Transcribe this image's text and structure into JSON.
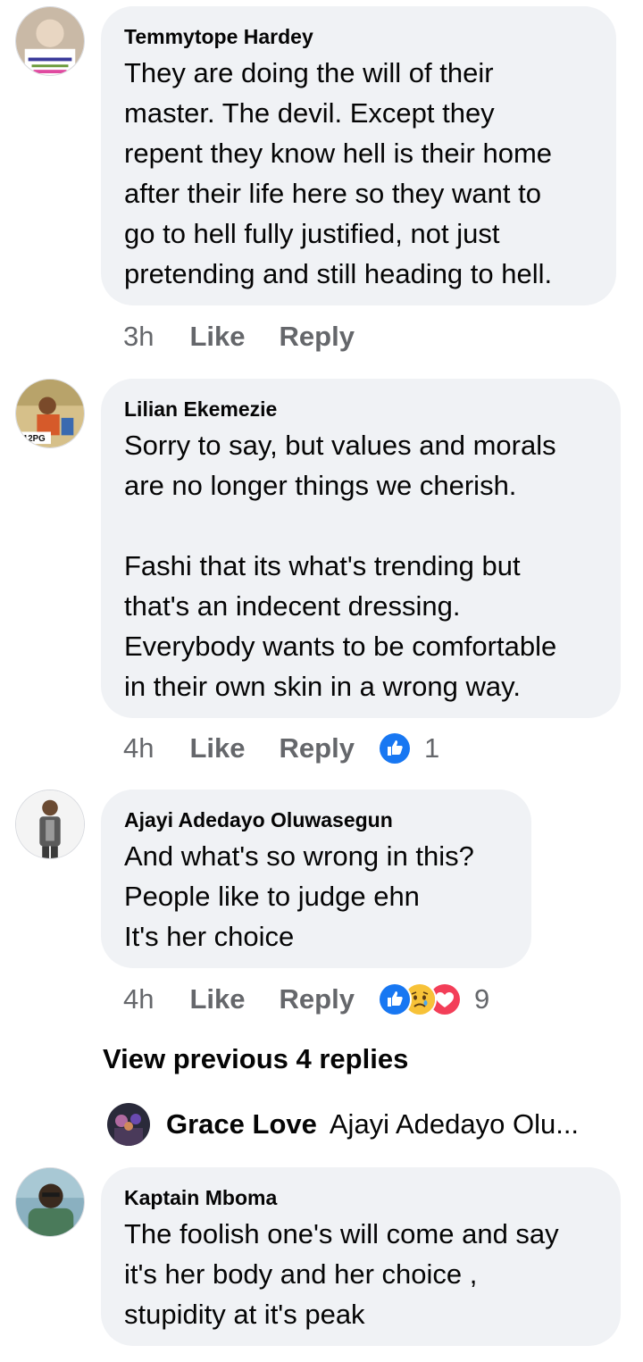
{
  "comments": [
    {
      "author": "Temmytope Hardey",
      "text": "They are doing the will of their\nmaster. The devil. Except they\nrepent they know hell is their home\nafter their life here so they want to\ngo to hell fully justified, not just\npretending and still heading to hell.",
      "time": "3h",
      "like_label": "Like",
      "reply_label": "Reply",
      "reaction_count": ""
    },
    {
      "author": "Lilian Ekemezie",
      "text": "Sorry to say, but values and morals\nare no longer things we cherish.\n\nFashi that its what's trending but\nthat's an indecent dressing.\nEverybody wants to be comfortable\nin their own skin in a wrong way.",
      "time": "4h",
      "like_label": "Like",
      "reply_label": "Reply",
      "reaction_count": "1",
      "reactions": [
        "like-icon"
      ]
    },
    {
      "author": "Ajayi Adedayo Oluwasegun",
      "text": "And what's so wrong in this?\nPeople like to judge ehn\nIt's her choice",
      "time": "4h",
      "like_label": "Like",
      "reply_label": "Reply",
      "reaction_count": "9",
      "reactions": [
        "like-icon",
        "sad-icon",
        "care-icon"
      ]
    },
    {
      "author": "Kaptain Mboma",
      "text": "The foolish one's will come and say\nit's her body and her choice ,\nstupidity at it's peak"
    }
  ],
  "view_previous_label": "View previous 4 replies",
  "reply_preview": {
    "author": "Grace Love",
    "text": "Ajayi Adedayo Olu..."
  },
  "colors": {
    "bubble": "#f0f2f5",
    "meta": "#65676b",
    "text": "#050505",
    "like_blue": "#1877f2"
  }
}
